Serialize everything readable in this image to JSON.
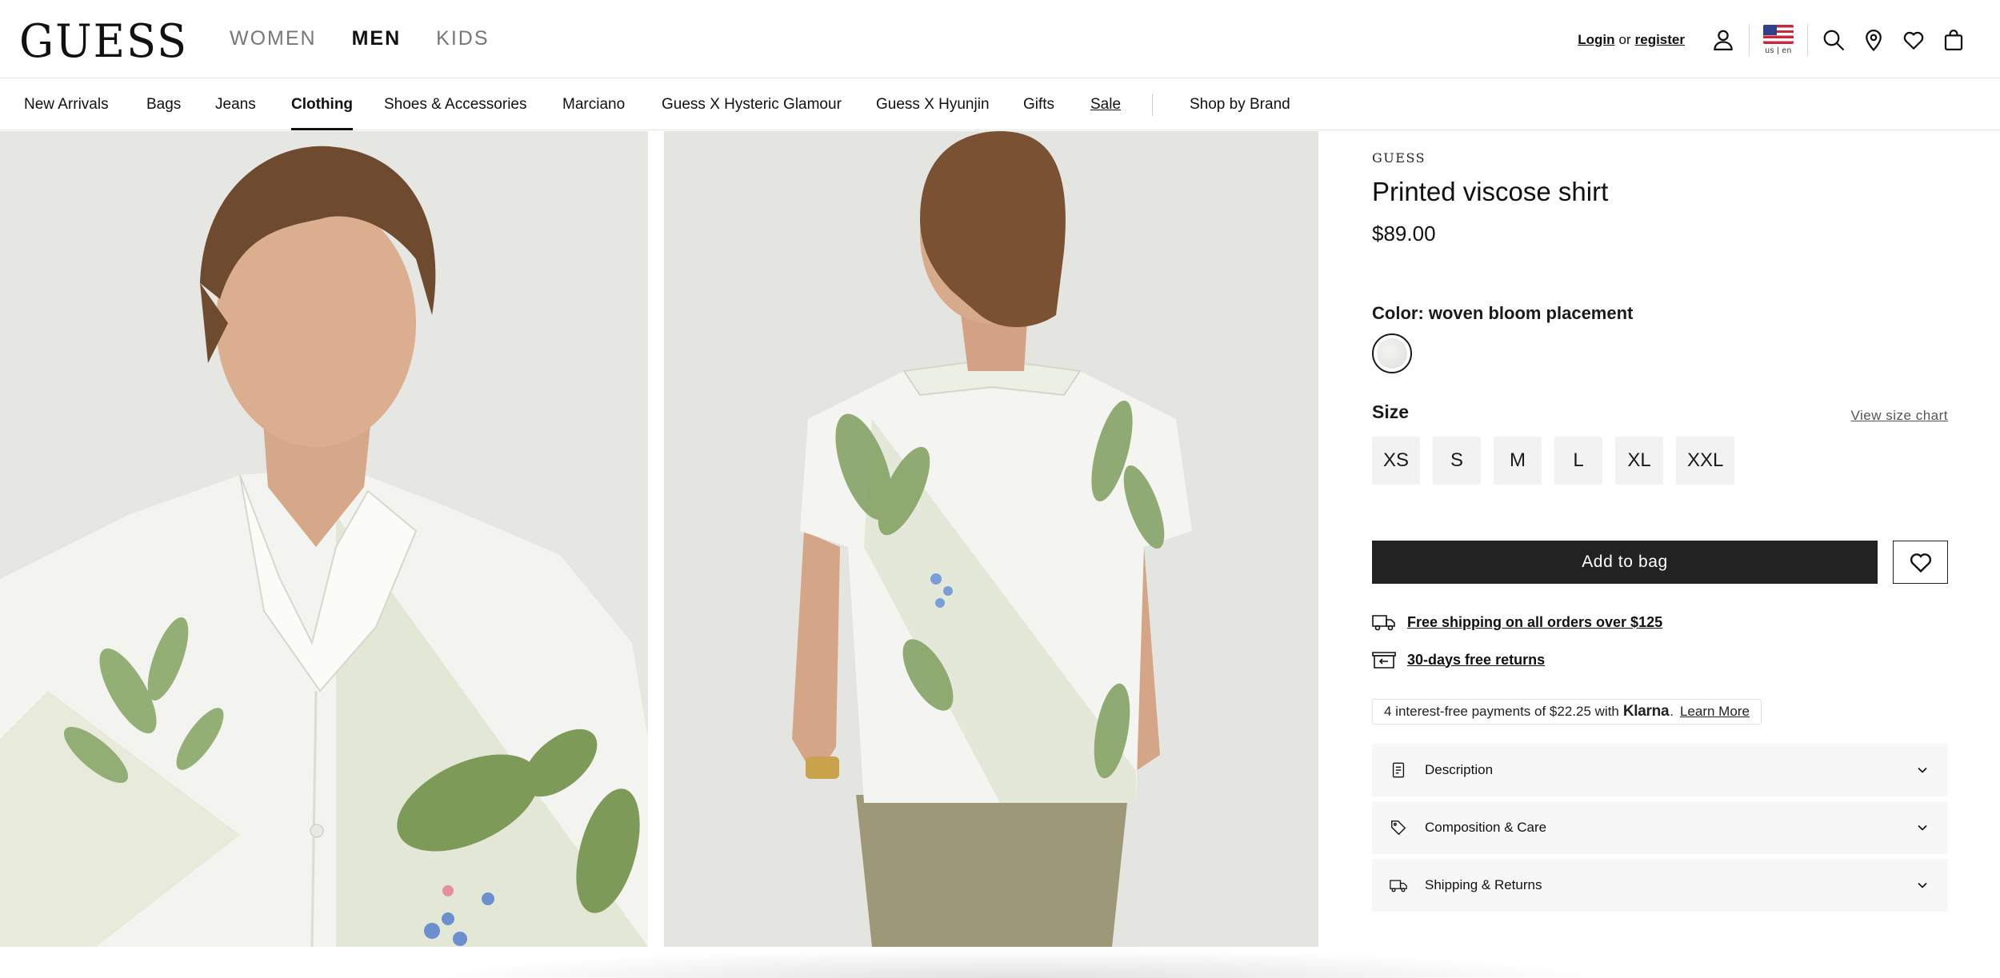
{
  "header": {
    "logo": "GUESS",
    "gender_nav": [
      {
        "label": "WOMEN",
        "active": false
      },
      {
        "label": "MEN",
        "active": true
      },
      {
        "label": "KIDS",
        "active": false
      }
    ],
    "login": "Login",
    "or": "or",
    "register": "register",
    "locale": "us | en",
    "icons": [
      "user-icon",
      "flag-us-icon",
      "search-icon",
      "location-pin-icon",
      "heart-icon",
      "shopping-bag-icon"
    ]
  },
  "category_nav": {
    "items": [
      "New Arrivals",
      "Bags",
      "Jeans",
      "Clothing",
      "Shoes & Accessories",
      "Marciano",
      "Guess X Hysteric Glamour",
      "Guess X Hyunjin",
      "Gifts",
      "Sale",
      "Shop by Brand"
    ],
    "active": "Clothing"
  },
  "product": {
    "brand": "GUESS",
    "name": "Printed viscose shirt",
    "price": "$89.00",
    "color_label": "Color: woven bloom placement",
    "size_label": "Size",
    "size_chart": "View size chart",
    "sizes": [
      "XS",
      "S",
      "M",
      "L",
      "XL",
      "XXL"
    ],
    "add_to_bag": "Add to bag",
    "perks": {
      "shipping": "Free shipping on all orders over $125",
      "returns": "30-days free returns"
    },
    "klarna": {
      "text": "4 interest-free payments of $22.25 with",
      "logo": "Klarna",
      "period": ".",
      "learn_more": "Learn More"
    },
    "accordions": {
      "description": "Description",
      "composition": "Composition & Care",
      "shipping": "Shipping & Returns"
    }
  },
  "colors": {
    "text": "#111111",
    "button": "#222222",
    "accordion_bg": "#f7f7f7",
    "size_bg": "#f2f2f2"
  }
}
